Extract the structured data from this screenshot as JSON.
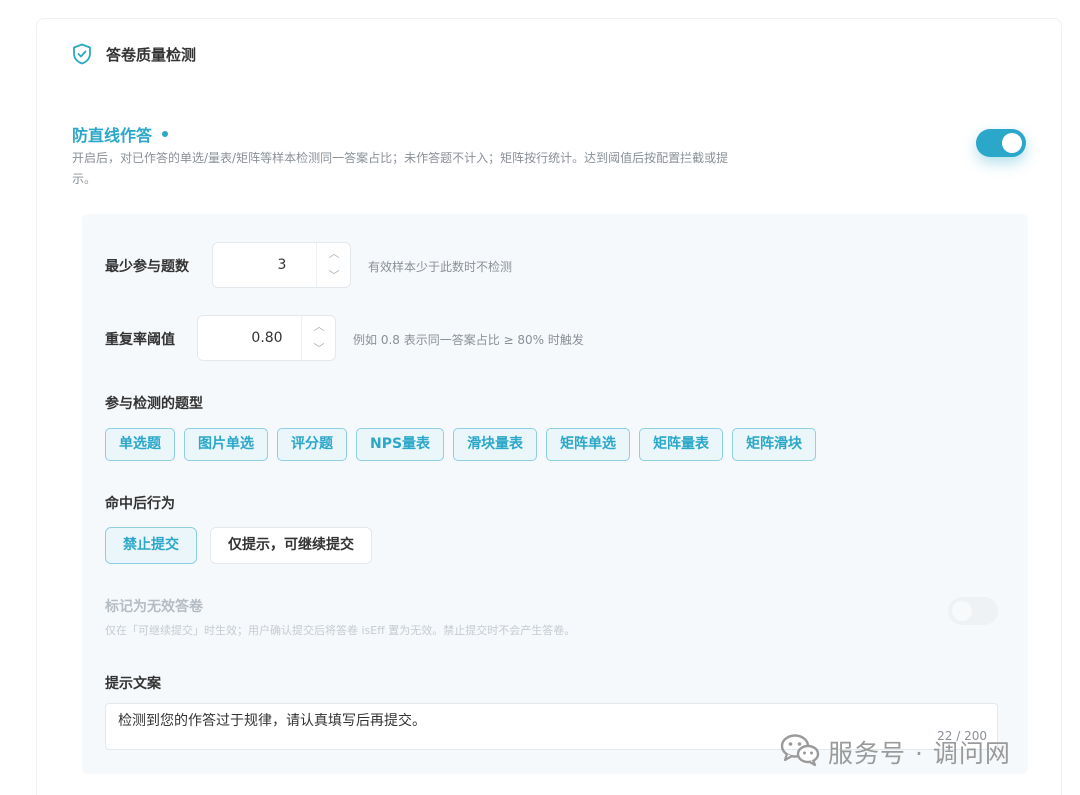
{
  "header": {
    "title": "答卷质量检测",
    "icon": "shield-check-icon"
  },
  "feature": {
    "title": "防直线作答",
    "description": "开启后，对已作答的单选/量表/矩阵等样本检测同一答案占比；未作答题不计入；矩阵按行统计。达到阈值后按配置拦截或提示。",
    "enabled": true
  },
  "settings": {
    "min_questions": {
      "label": "最少参与题数",
      "value": "3",
      "hint": "有效样本少于此数时不检测"
    },
    "repeat_threshold": {
      "label": "重复率阈值",
      "value": "0.80",
      "hint": "例如 0.8 表示同一答案占比 ≥ 80% 时触发"
    },
    "question_types": {
      "label": "参与检测的题型",
      "items": [
        "单选题",
        "图片单选",
        "评分题",
        "NPS量表",
        "滑块量表",
        "矩阵单选",
        "矩阵量表",
        "矩阵滑块"
      ]
    },
    "action": {
      "label": "命中后行为",
      "options": [
        "禁止提交",
        "仅提示，可继续提交"
      ],
      "selected": "禁止提交"
    },
    "mark_invalid": {
      "label": "标记为无效答卷",
      "description": "仅在「可继续提交」时生效；用户确认提交后将答卷 isEff 置为无效。禁止提交时不会产生答卷。",
      "enabled": false
    },
    "prompt_text": {
      "label": "提示文案",
      "value": "检测到您的作答过于规律，请认真填写后再提交。",
      "count": "22 / 200"
    }
  },
  "colors": {
    "accent": "#2aa7c9",
    "tag_bg": "#eaf6fa",
    "panel_bg": "#f6f9fb"
  },
  "watermark": {
    "text": "服务号 · 调问网",
    "icon": "wechat-icon"
  }
}
